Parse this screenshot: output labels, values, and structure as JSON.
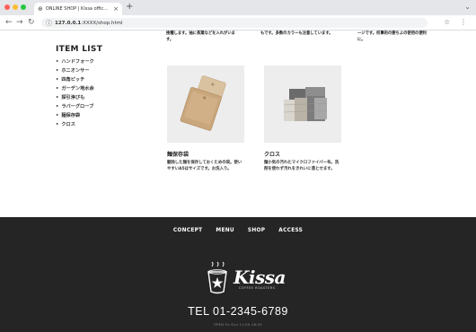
{
  "browser": {
    "tab_title": "ONLINE SHOP | Kissa offic...",
    "tab_close": "×",
    "new_tab": "+",
    "url_host": "127.0.0.1",
    "url_rest": ":XXXX/shop.html",
    "tab_menu": "⌄"
  },
  "top_texts": [
    "挽種します。抽に茶葉などを入れがいます。",
    "もです。多数のカラーも注意しています。",
    "一ジです。何事的の要ちよの使用の便利に。"
  ],
  "sidebar": {
    "title": "ITEM LIST",
    "items": [
      "ハンドフォーク",
      "ホニオンサー",
      "四角ピッチ",
      "ガーデン地水余",
      "探引浄びも",
      "ラバーグローブ",
      "麺保存袋",
      "クロス"
    ]
  },
  "products": [
    {
      "name": "麺保存袋",
      "desc": "駆除した麺を保存しておくための袋。使いやすいA5ほサイズです。お洗入り。"
    },
    {
      "name": "クロス",
      "desc": "麺小気の汚れたマイクロファイバー布。洗剤を使わず汚れをきれいに落とせます。"
    }
  ],
  "footer": {
    "nav": [
      "CONCEPT",
      "MENU",
      "SHOP",
      "ACCESS"
    ],
    "logo_text": "Kissa",
    "logo_sub": "COFFEE ROASTERS",
    "tel": "TEL 01-2345-6789",
    "hours": "OPEN Fri-Sun 11:00-18:00"
  },
  "colors": {
    "footer_bg": "#252525",
    "page_bg": "#ffffff",
    "product_img_bg": "#ededed"
  }
}
